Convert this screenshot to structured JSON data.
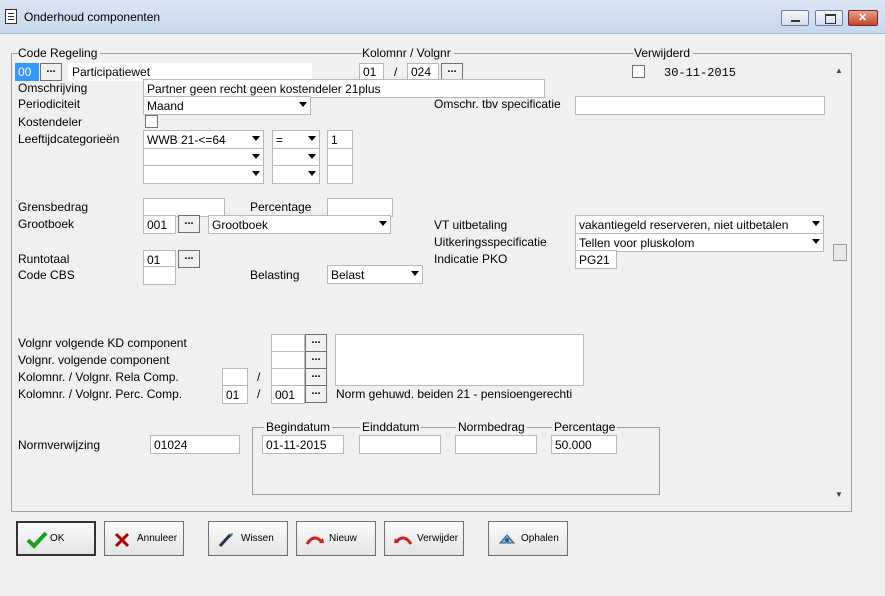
{
  "window": {
    "title": "Onderhoud componenten"
  },
  "group": {
    "code_regeling": "Code Regeling",
    "kolomnr_volgnr": "Kolomnr / Volgnr",
    "verwijderd": "Verwijderd"
  },
  "regeling": {
    "code": "00",
    "name": "Participatiewet"
  },
  "kolom": {
    "kolomnr": "01",
    "sep": "/",
    "volgnr": "024"
  },
  "verwijderd": {
    "date": "30-11-2015"
  },
  "labels": {
    "omschrijving": "Omschrijving",
    "periodiciteit": "Periodiciteit",
    "omschr_spec": "Omschr. tbv specificatie",
    "kostendeler": "Kostendeler",
    "leeftijd": "Leeftijdcategorieën",
    "grensbedrag": "Grensbedrag",
    "percentage": "Percentage",
    "grootboek": "Grootboek",
    "vt_uitbetaling": "VT uitbetaling",
    "uitkeringsspec": "Uitkeringsspecificatie",
    "indicatie_pko": "Indicatie PKO",
    "runtotaal": "Runtotaal",
    "code_cbs": "Code CBS",
    "belasting": "Belasting",
    "volgnr_kd": "Volgnr volgende KD component",
    "volgnr_comp": "Volgnr. volgende component",
    "rela_comp": "Kolomnr. / Volgnr. Rela Comp.",
    "perc_comp": "Kolomnr. / Volgnr. Perc. Comp.",
    "normverwijzing": "Normverwijzing",
    "begindatum": "Begindatum",
    "einddatum": "Einddatum",
    "normbedrag": "Normbedrag",
    "percentage2": "Percentage"
  },
  "values": {
    "omschrijving": "Partner geen recht geen kostendeler 21plus",
    "periodiciteit": "Maand",
    "omschr_spec": "",
    "leeftijd_cat": "WWB 21-<=64",
    "leeftijd_op": "=",
    "leeftijd_num": "1",
    "grootboek_code": "001",
    "grootboek_name": "Grootboek",
    "vt_uitbetaling": "vakantiegeld reserveren, niet uitbetalen",
    "uitkeringsspec": "Tellen voor pluskolom",
    "indicatie_pko": "PG21",
    "runtotaal": "01",
    "belasting": "Belast",
    "perc_kolom": "01",
    "perc_volg": "001",
    "norm_text": "Norm gehuwd.  beiden 21 - pensioengerechti",
    "normverwijzing": "01024",
    "begindatum": "01-11-2015",
    "einddatum": "",
    "normbedrag": "",
    "percentage": "50.000",
    "sep": "/",
    "dots": "..."
  },
  "buttons": {
    "ok": "OK",
    "annuleer": "Annuleer",
    "wissen": "Wissen",
    "nieuw": "Nieuw",
    "verwijder": "Verwijder",
    "ophalen": "Ophalen"
  },
  "colors": {
    "ok_check": "#1aa01a",
    "annuleer_x": "#b00000",
    "nieuw_arrow": "#d02020",
    "selected_code": "#3399ff"
  }
}
